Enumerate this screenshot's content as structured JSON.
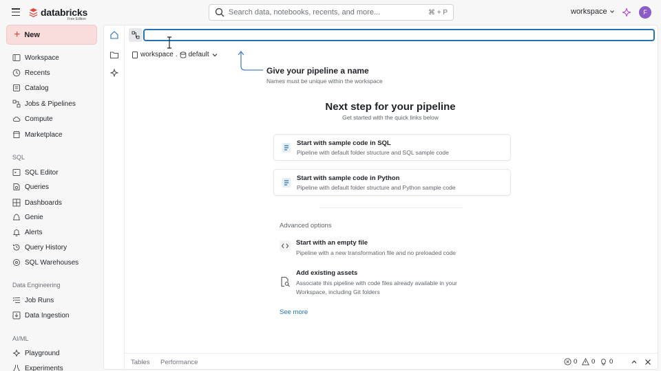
{
  "topbar": {
    "brand": "databricks",
    "brand_sub": "Free Edition",
    "search_placeholder": "Search data, notebooks, recents, and more...",
    "search_shortcut": "⌘ + P",
    "workspace_label": "workspace",
    "avatar_initial": "F"
  },
  "sidebar": {
    "new_label": "New",
    "items_top": [
      {
        "label": "Workspace",
        "icon": "workspace-icon"
      },
      {
        "label": "Recents",
        "icon": "clock-icon"
      },
      {
        "label": "Catalog",
        "icon": "catalog-icon"
      },
      {
        "label": "Jobs & Pipelines",
        "icon": "workflow-icon"
      },
      {
        "label": "Compute",
        "icon": "cloud-icon"
      },
      {
        "label": "Marketplace",
        "icon": "store-icon"
      }
    ],
    "sql_section": "SQL",
    "items_sql": [
      {
        "label": "SQL Editor",
        "icon": "editor-icon"
      },
      {
        "label": "Queries",
        "icon": "query-icon"
      },
      {
        "label": "Dashboards",
        "icon": "dashboard-icon"
      },
      {
        "label": "Genie",
        "icon": "genie-icon"
      },
      {
        "label": "Alerts",
        "icon": "bell-icon"
      },
      {
        "label": "Query History",
        "icon": "history-icon"
      },
      {
        "label": "SQL Warehouses",
        "icon": "warehouse-icon"
      }
    ],
    "de_section": "Data Engineering",
    "items_de": [
      {
        "label": "Job Runs",
        "icon": "list-icon"
      },
      {
        "label": "Data Ingestion",
        "icon": "ingest-icon"
      }
    ],
    "ai_section": "AI/ML",
    "items_ai": [
      {
        "label": "Playground",
        "icon": "sparkle-icon"
      },
      {
        "label": "Experiments",
        "icon": "flask-icon"
      }
    ]
  },
  "editor": {
    "name_value": "",
    "crumb_workspace": "workspace",
    "crumb_sep": ".",
    "crumb_schema": "default",
    "hint_title": "Give your pipeline a name",
    "hint_sub": "Names must be unique within the workspace",
    "next_title": "Next step for your pipeline",
    "next_sub": "Get started with the quick links below",
    "cards": [
      {
        "title": "Start with sample code in SQL",
        "sub": "Pipeline with default folder structure and SQL sample code"
      },
      {
        "title": "Start with sample code in Python",
        "sub": "Pipeline with default folder structure and Python sample code"
      }
    ],
    "advanced_label": "Advanced options",
    "options": [
      {
        "title": "Start with an empty file",
        "sub": "Pipeline with a new transformation file and no preloaded code"
      },
      {
        "title": "Add existing assets",
        "sub": "Associate this pipeline with code files already available in your Workspace, including Git folders"
      }
    ],
    "see_more": "See more"
  },
  "bottom": {
    "tabs": [
      "Tables",
      "Performance"
    ],
    "errors": "0",
    "warnings": "0",
    "hints": "0"
  },
  "colors": {
    "accent": "#2272b4",
    "brand": "#e0483b",
    "new_bg": "#f9dcdc",
    "avatar": "#8b5bc9"
  }
}
